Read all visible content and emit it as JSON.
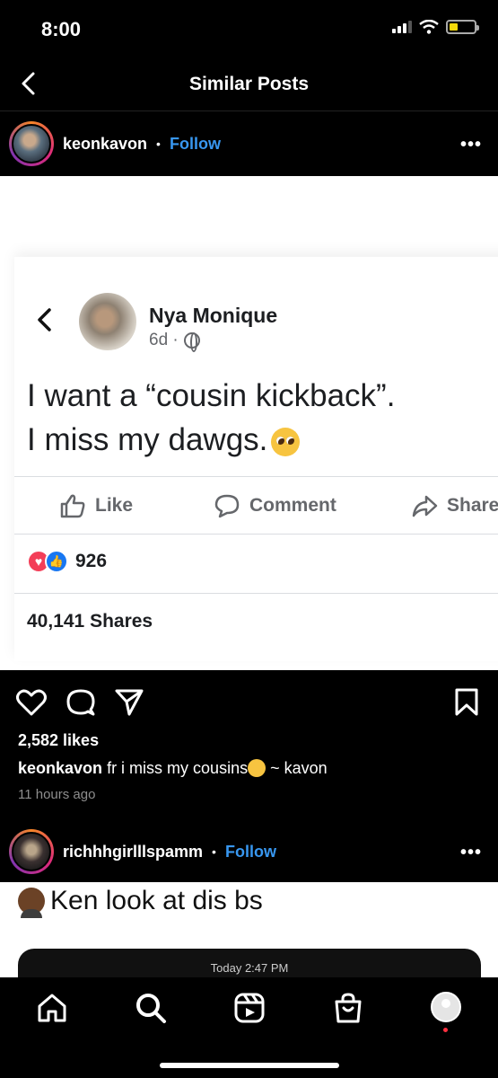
{
  "status": {
    "time": "8:00"
  },
  "nav": {
    "title": "Similar Posts"
  },
  "post1": {
    "username": "keonkavon",
    "follow_label": "Follow",
    "more": "•••",
    "image": {
      "author": "Nya Monique",
      "age": "6d ·",
      "text_line1": "I want a “cousin kickback”.",
      "text_line2": "I miss my dawgs.",
      "like_label": "Like",
      "comment_label": "Comment",
      "share_label": "Share",
      "reaction_count": "926",
      "shares": "40,141 Shares"
    },
    "likes": "2,582 likes",
    "caption_user": "keonkavon",
    "caption_text": "fr i miss my cousins",
    "caption_tail": "~ kavon",
    "time_ago": "11 hours ago"
  },
  "post2": {
    "username": "richhhgirlllspamm",
    "follow_label": "Follow",
    "more": "•••",
    "image": {
      "text": "Ken look at dis bs",
      "timestamp": "Today 2:47 PM"
    }
  },
  "colors": {
    "follow": "#3897f0",
    "background": "#000000",
    "notif": "#ff3040"
  },
  "icons": [
    "back-icon",
    "heart-icon",
    "comment-icon",
    "share-icon",
    "bookmark-icon",
    "home-icon",
    "search-icon",
    "reels-icon",
    "shop-icon",
    "profile-icon"
  ]
}
